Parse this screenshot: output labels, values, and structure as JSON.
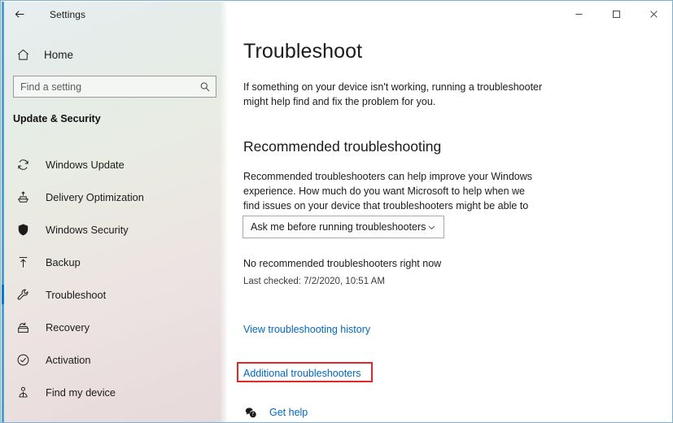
{
  "window": {
    "app_title": "Settings",
    "back_icon": "back-arrow-icon",
    "controls": {
      "minimize": "minimize-icon",
      "maximize": "maximize-icon",
      "close": "close-icon"
    }
  },
  "sidebar": {
    "home": {
      "label": "Home",
      "icon": "home-icon"
    },
    "search": {
      "placeholder": "Find a setting",
      "value": "",
      "icon": "search-icon"
    },
    "group_title": "Update & Security",
    "items": [
      {
        "label": "Windows Update",
        "icon": "sync-refresh-icon",
        "selected": false
      },
      {
        "label": "Delivery Optimization",
        "icon": "upload-box-icon",
        "selected": false
      },
      {
        "label": "Windows Security",
        "icon": "shield-icon",
        "selected": false
      },
      {
        "label": "Backup",
        "icon": "backup-upload-icon",
        "selected": false
      },
      {
        "label": "Troubleshoot",
        "icon": "wrench-icon",
        "selected": true
      },
      {
        "label": "Recovery",
        "icon": "recovery-icon",
        "selected": false
      },
      {
        "label": "Activation",
        "icon": "check-circle-icon",
        "selected": false
      },
      {
        "label": "Find my device",
        "icon": "person-locator-icon",
        "selected": false
      }
    ]
  },
  "main": {
    "page_title": "Troubleshoot",
    "page_description": "If something on your device isn't working, running a troubleshooter might help find and fix the problem for you.",
    "section": {
      "title": "Recommended troubleshooting",
      "description": "Recommended troubleshooters can help improve your Windows experience. How much do you want Microsoft to help when we find issues on your device that troubleshooters might be able to fix?",
      "dropdown": {
        "selected": "Ask me before running troubleshooters",
        "chevron_icon": "chevron-down-icon",
        "options": [
          "Ask me before running troubleshooters"
        ]
      },
      "status_primary": "No recommended troubleshooters right now",
      "status_secondary": "Last checked: 7/2/2020, 10:51 AM"
    },
    "links": {
      "history": "View troubleshooting history",
      "additional": "Additional troubleshooters"
    },
    "get_help": {
      "label": "Get help",
      "icon": "help-bubble-icon"
    }
  },
  "annotation": {
    "target": "Additional troubleshooters",
    "color": "#e02828"
  },
  "colors": {
    "accent_blue": "#0078d4",
    "link_blue": "#0067c0",
    "annotation_red": "#e02828",
    "text": "#1b1b1b"
  }
}
